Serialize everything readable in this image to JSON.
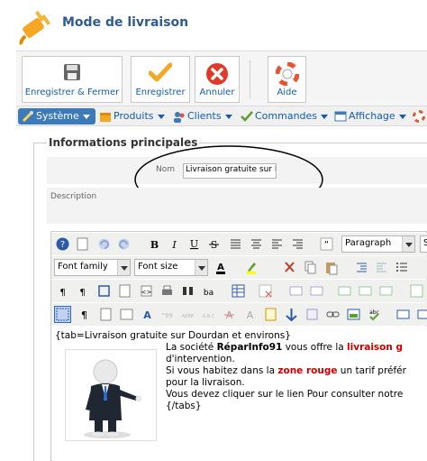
{
  "header": {
    "title": "Mode de livraison",
    "logo_icon": "plug-icon"
  },
  "toolbar": {
    "save_close": "Enregistrer & Fermer",
    "save": "Enregistrer",
    "cancel": "Annuler",
    "help": "Aide"
  },
  "menu": {
    "items": [
      "Système",
      "Produits",
      "Clients",
      "Commandes",
      "Affichage"
    ]
  },
  "form": {
    "legend": "Informations principales",
    "name_label": "Nom",
    "name_value": "Livraison gratuite sur Dourdan et environs",
    "description_label": "Description"
  },
  "editor": {
    "format_value": "Paragraph",
    "font_family": "Font family",
    "font_size": "Font size",
    "content": {
      "line1": "{tab=Livraison gratuite sur Dourdan et environs}",
      "l2_a": "La société ",
      "l2_b": "RéparInfo91",
      "l2_c": " vous offre la ",
      "l2_d": "livraison g",
      "line3": "d'intervention.",
      "l4_a": "Si vous habitez dans la ",
      "l4_b": "zone rouge",
      "l4_c": " un tarif préfér",
      "line5": "pour la livraison.",
      "line6": "Vous devez cliquer sur le lien Pour consulter notre",
      "line7": "{/tabs}"
    }
  },
  "colors": {
    "title": "#2f5b8f",
    "accent": "#135cae",
    "active_menu": "#3d7bb8",
    "highlight_red": "#cc0000"
  }
}
